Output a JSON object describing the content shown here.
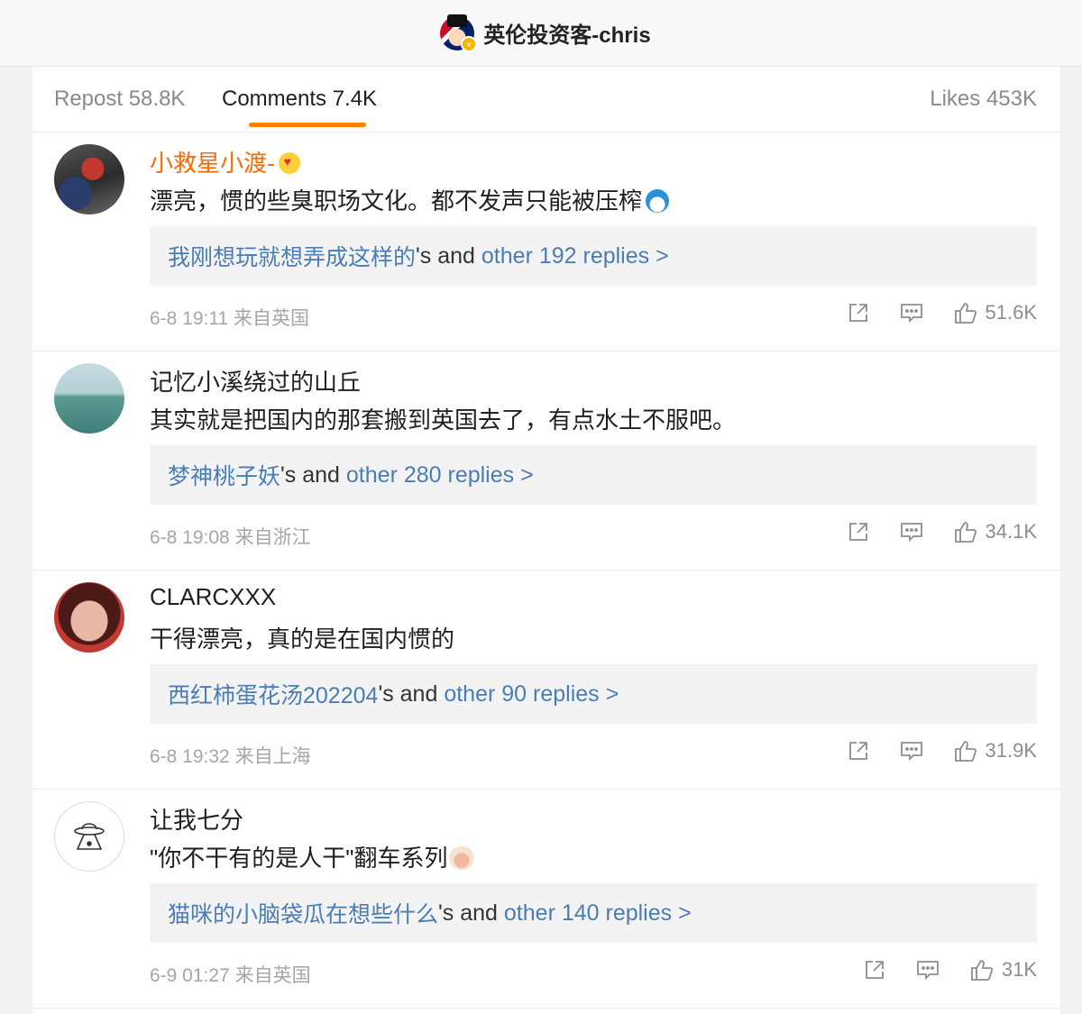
{
  "header": {
    "title": "英伦投资客-chris"
  },
  "tabs": [
    {
      "label": "Repost 58.8K"
    },
    {
      "label": "Comments 7.4K"
    },
    {
      "label": "Likes 453K"
    }
  ],
  "comments": [
    {
      "name": "小救星小渡-",
      "text": "漂亮，惯的些臭职场文化。都不发声只能被压榨",
      "reply_user": "我刚想玩就想弄成这样的",
      "reply_mid": "'s and ",
      "reply_more": "other 192 replies >",
      "time": "6-8 19:11 来自英国",
      "likes": "51.6K"
    },
    {
      "name": "记忆小溪绕过的山丘",
      "text": "其实就是把国内的那套搬到英国去了，有点水土不服吧。",
      "reply_user": "梦神桃子妖",
      "reply_mid": "'s and ",
      "reply_more": "other 280 replies >",
      "time": "6-8 19:08 来自浙江",
      "likes": "34.1K"
    },
    {
      "name": "CLARCXXX",
      "text": "干得漂亮，真的是在国内惯的",
      "reply_user": "西红柿蛋花汤202204",
      "reply_mid": "'s and ",
      "reply_more": "other 90 replies >",
      "time": "6-8 19:32 来自上海",
      "likes": "31.9K"
    },
    {
      "name": "让我七分",
      "text": "\"你不干有的是人干\"翻车系列",
      "reply_user": "猫咪的小脑袋瓜在想些什么",
      "reply_mid": "'s and ",
      "reply_more": "other 140 replies >",
      "time": "6-9 01:27 来自英国",
      "likes": "31K"
    }
  ],
  "colors": {
    "accent": "#ff8200",
    "link": "#4a7db5",
    "highlight_name": "#ff6a00"
  },
  "icons": [
    "share-icon",
    "comment-icon",
    "thumbs-up-icon"
  ]
}
